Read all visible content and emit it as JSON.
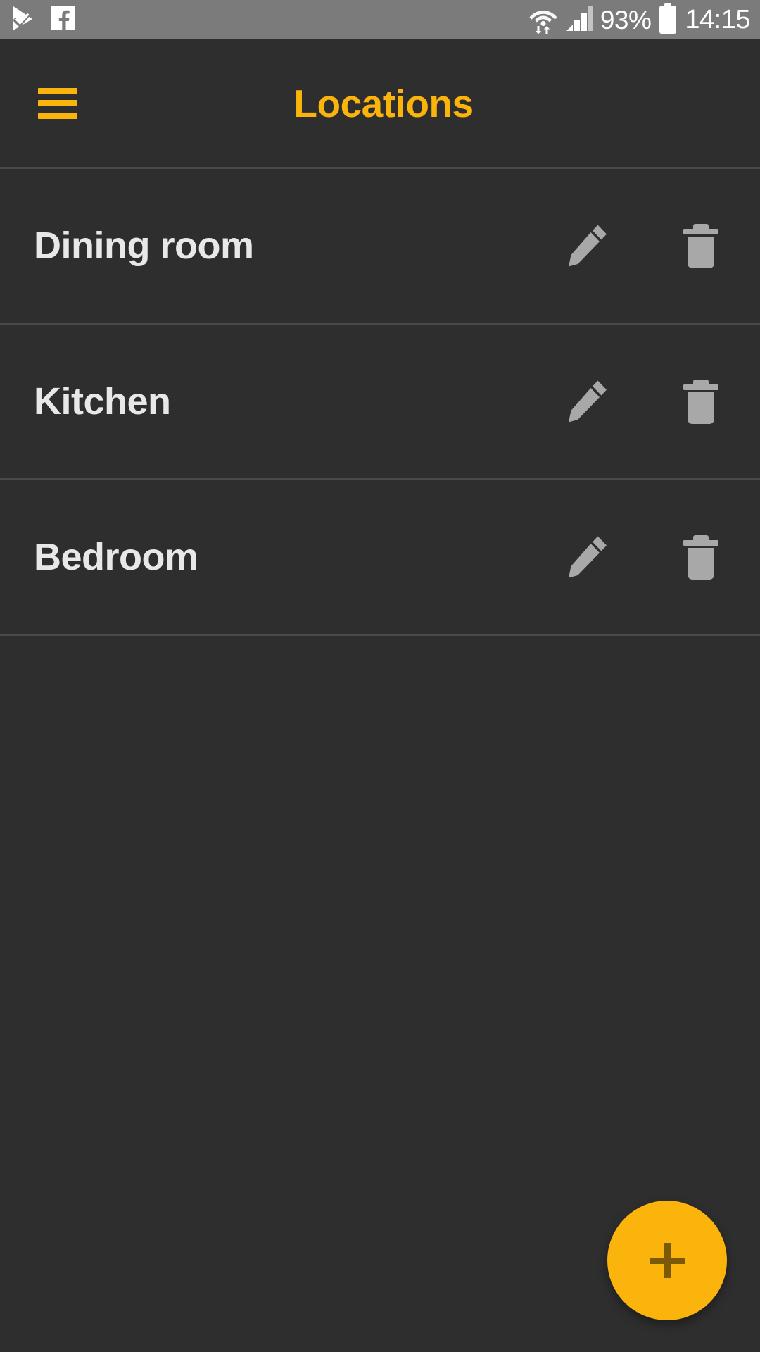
{
  "status_bar": {
    "background": "#7b7b7b",
    "left_icons": [
      {
        "name": "play-store-update-icon",
        "label": "play-store-update"
      },
      {
        "name": "facebook-icon",
        "label": "facebook"
      }
    ],
    "right_icons": [
      {
        "name": "wifi-icon",
        "label": "wifi"
      },
      {
        "name": "cellular-signal-icon",
        "label": "cellular-signal"
      },
      {
        "name": "battery-icon",
        "label": "battery"
      }
    ],
    "battery_percent": "93%",
    "clock": "14:15"
  },
  "app_bar": {
    "title": "Locations",
    "menu_icon": "hamburger-menu-icon",
    "accent_color": "#fbb40c"
  },
  "list": {
    "rows": [
      {
        "label": "Dining room",
        "edit_icon": "pencil-icon",
        "delete_icon": "trash-icon"
      },
      {
        "label": "Kitchen",
        "edit_icon": "pencil-icon",
        "delete_icon": "trash-icon"
      },
      {
        "label": "Bedroom",
        "edit_icon": "pencil-icon",
        "delete_icon": "trash-icon"
      }
    ],
    "icon_color": "#a8a8a8",
    "divider_color": "#4a4a4a",
    "row_background": "#2e2e2e",
    "label_color": "#e8e8e8"
  },
  "fab": {
    "icon": "plus-icon",
    "background": "#fbb40c",
    "glyph_color": "#7a5a06",
    "action_label": "Add location"
  }
}
